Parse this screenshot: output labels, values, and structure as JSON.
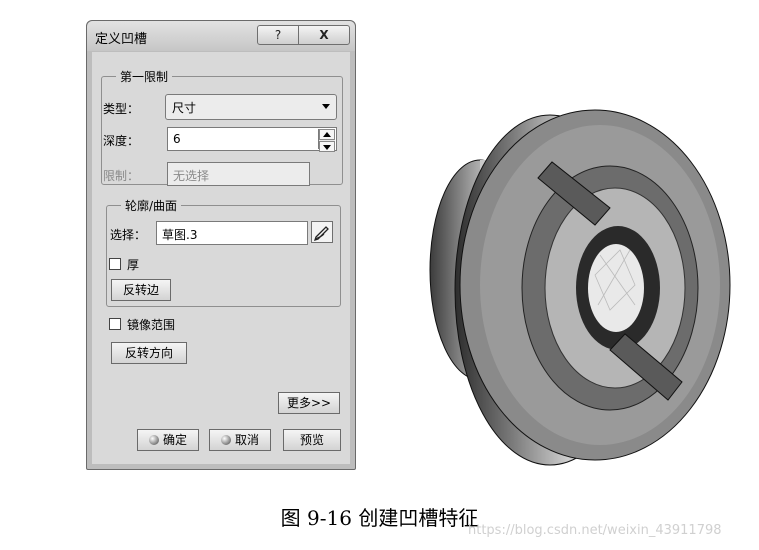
{
  "dialog": {
    "title": "定义凹槽",
    "help_btn": "?",
    "close_btn": "X",
    "first_limit": {
      "group_label": "第一限制",
      "type_label": "类型：",
      "type_value": "尺寸",
      "depth_label": "深度：",
      "depth_value": "6",
      "limit_label": "限制：",
      "limit_value": "无选择"
    },
    "profile": {
      "group_label": "轮廓/曲面",
      "select_label": "选择：",
      "select_value": "草图.3",
      "thick_label": "厚",
      "reverse_side_btn": "反转边"
    },
    "mirror_label": "镜像范围",
    "reverse_dir_btn": "反转方向",
    "more_btn": "更多>>",
    "ok_btn": "确定",
    "cancel_btn": "取消",
    "preview_btn": "预览"
  },
  "caption": "图 9-16    创建凹槽特征",
  "watermark": "https://blog.csdn.net/weixin_43911798"
}
